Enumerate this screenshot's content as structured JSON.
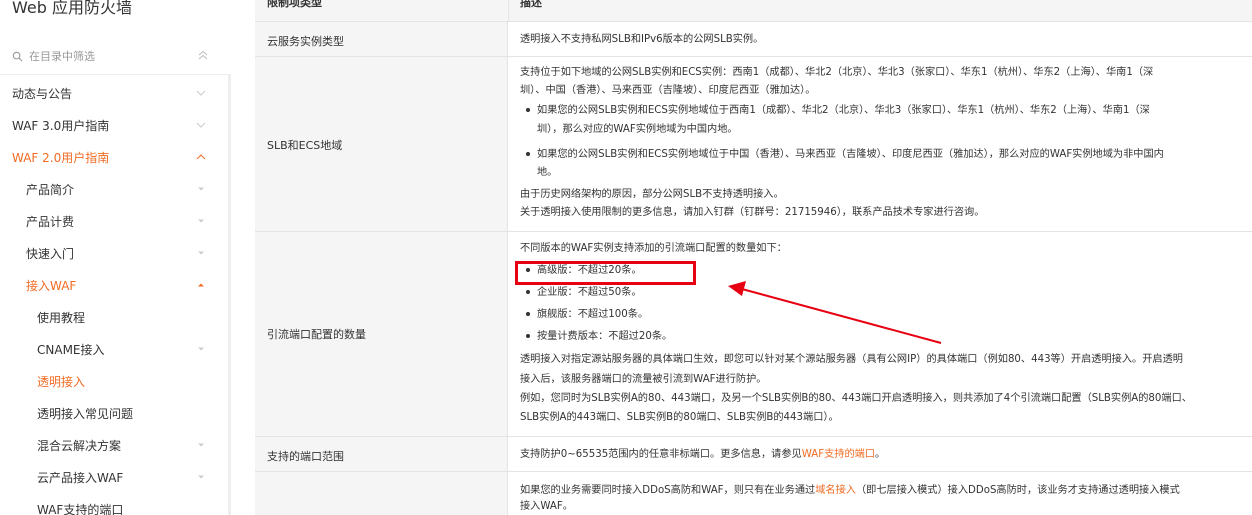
{
  "sidebar": {
    "title": "Web 应用防火墙",
    "search_placeholder": "在目录中筛选",
    "items": [
      {
        "label": "动态与公告",
        "state": "collapsed"
      },
      {
        "label": "WAF 3.0用户指南",
        "state": "collapsed"
      },
      {
        "label": "WAF 2.0用户指南",
        "state": "expanded-active"
      },
      {
        "label": "产品简介",
        "state": "collapsed"
      },
      {
        "label": "产品计费",
        "state": "collapsed"
      },
      {
        "label": "快速入门",
        "state": "collapsed"
      },
      {
        "label": "接入WAF",
        "state": "expanded-active"
      },
      {
        "label": "使用教程",
        "state": "leaf"
      },
      {
        "label": "CNAME接入",
        "state": "collapsed"
      },
      {
        "label": "透明接入",
        "state": "active-leaf"
      },
      {
        "label": "透明接入常见问题",
        "state": "leaf"
      },
      {
        "label": "混合云解决方案",
        "state": "collapsed"
      },
      {
        "label": "云产品接入WAF",
        "state": "collapsed"
      },
      {
        "label": "WAF支持的端口",
        "state": "leaf"
      }
    ]
  },
  "table": {
    "header": {
      "col1": "限制项类型",
      "col2": "描述"
    },
    "rows": {
      "r1": {
        "type": "云服务实例类型",
        "lines": [
          "透明接入不支持私网SLB和IPv6版本的公网SLB实例。"
        ]
      },
      "r2": {
        "type": "SLB和ECS地域",
        "lines": [
          "支持位于如下地域的公网SLB实例和ECS实例：西南1（成都）、华北2（北京）、华北3（张家口）、华东1（杭州）、华东2（上海）、华南1（深",
          "圳）、中国（香港）、马来西亚（吉隆坡）、印度尼西亚（雅加达）。",
          "如果您的公网SLB实例和ECS实例地域位于西南1（成都）、华北2（北京）、华北3（张家口）、华东1（杭州）、华东2（上海）、华南1（深",
          "圳），那么对应的WAF实例地域为中国内地。",
          "如果您的公网SLB实例和ECS实例地域位于中国（香港）、马来西亚（吉隆坡）、印度尼西亚（雅加达），那么对应的WAF实例地域为非中国内",
          "地。",
          "由于历史网络架构的原因，部分公网SLB不支持透明接入。",
          "关于透明接入使用限制的更多信息，请加入钉群（钉群号：21715946），联系产品技术专家进行咨询。"
        ]
      },
      "r3": {
        "type": "引流端口配置的数量",
        "lines": [
          "不同版本的WAF实例支持添加的引流端口配置的数量如下：",
          "高级版：不超过20条。",
          "企业版：不超过50条。",
          "旗舰版：不超过100条。",
          "按量计费版本：不超过20条。",
          "透明接入对指定源站服务器的具体端口生效，即您可以针对某个源站服务器（具有公网IP）的具体端口（例如80、443等）开启透明接入。开启透明",
          "接入后，该服务器端口的流量被引流到WAF进行防护。",
          "例如，您同时为SLB实例A的80、443端口，及另一个SLB实例B的80、443端口开启透明接入，则共添加了4个引流端口配置（SLB实例A的80端口、",
          "SLB实例A的443端口、SLB实例B的80端口、SLB实例B的443端口）。"
        ]
      },
      "r4": {
        "type": "支持的端口范围",
        "text_before": "支持防护0~65535范围内的任意非标端口。更多信息，请参见",
        "link": "WAF支持的端口",
        "text_after": "。"
      },
      "r5": {
        "type": "",
        "line1_before": "如果您的业务需要同时接入DDoS高防和WAF，则只有在业务通过",
        "line1_link": "域名接入",
        "line1_after": "（即七层接入模式）接入DDoS高防时，该业务才支持通过透明接入模式",
        "line2": "接入WAF。"
      }
    }
  },
  "colors": {
    "accent": "#f26b23",
    "highlight": "#e60012",
    "header_bg": "#f5f5f5"
  }
}
